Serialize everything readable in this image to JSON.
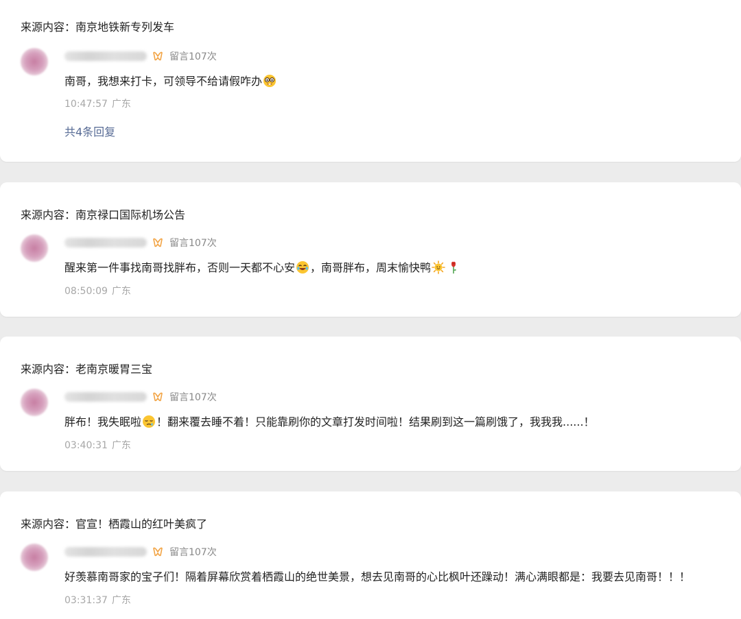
{
  "comments": [
    {
      "source_prefix": "来源内容：",
      "source_title": "南京地铁新专列发车",
      "reply_count": "留言107次",
      "text_parts": [
        "南哥，我想来打卡，可领导不给请假咋办"
      ],
      "emojis": [
        "nerd-face-emoji"
      ],
      "time": "10:47:57",
      "location": "广东",
      "replies_label": "共4条回复"
    },
    {
      "source_prefix": "来源内容：",
      "source_title": "南京禄口国际机场公告",
      "reply_count": "留言107次",
      "text_parts": [
        "醒来第一件事找南哥找胖布，否则一天都不心安",
        "，南哥胖布，周末愉快鸭"
      ],
      "emojis": [
        "lol-face-emoji",
        "sun-emoji",
        "rose-emoji"
      ],
      "time": "08:50:09",
      "location": "广东"
    },
    {
      "source_prefix": "来源内容：",
      "source_title": "老南京暖胃三宝",
      "reply_count": "留言107次",
      "text_parts": [
        "胖布！我失眠啦",
        "！翻来覆去睡不着！只能靠刷你的文章打发时间啦！结果刷到这一篇刷饿了，我我我......！"
      ],
      "emojis": [
        "sleepy-face-emoji"
      ],
      "time": "03:40:31",
      "location": "广东"
    },
    {
      "source_prefix": "来源内容：",
      "source_title": "官宣！栖霞山的红叶美疯了",
      "reply_count": "留言107次",
      "text_parts": [
        "好羡慕南哥家的宝子们！隔着屏幕欣赏着栖霞山的绝世美景，想去见南哥的心比枫叶还躁动！满心满眼都是：我要去见南哥！！！"
      ],
      "emojis": [],
      "time": "03:31:37",
      "location": "广东"
    }
  ],
  "colors": {
    "background": "#ececec",
    "card": "#ffffff",
    "text": "#222222",
    "meta": "#888888",
    "time": "#a7a7a7",
    "link": "#576b95",
    "badge": "#f2a343"
  }
}
